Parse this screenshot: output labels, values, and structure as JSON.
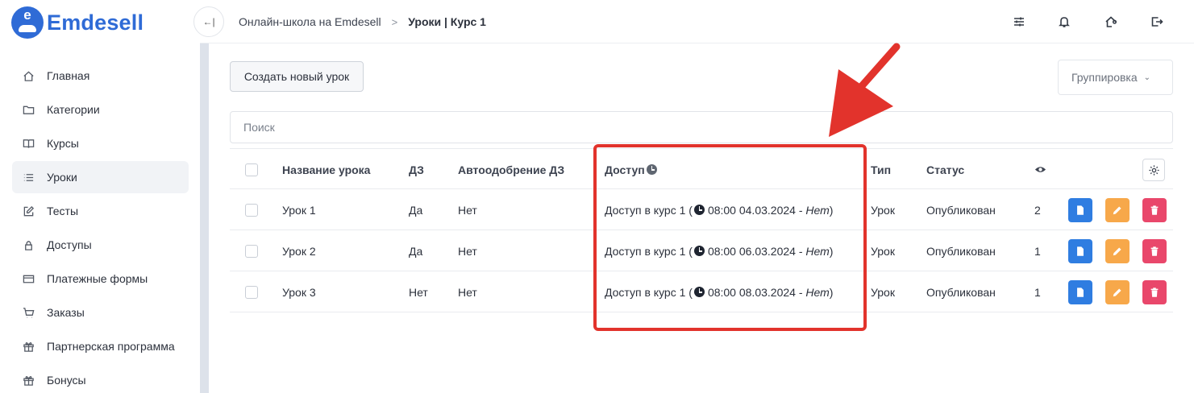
{
  "brand": {
    "name": "Emdesell",
    "logo_letter": "e",
    "color": "#2f6bd6"
  },
  "sidebar": {
    "items": [
      {
        "label": "Главная",
        "icon": "home-icon",
        "active": false
      },
      {
        "label": "Категории",
        "icon": "folder-icon",
        "active": false
      },
      {
        "label": "Курсы",
        "icon": "book-icon",
        "active": false
      },
      {
        "label": "Уроки",
        "icon": "list-icon",
        "active": true
      },
      {
        "label": "Тесты",
        "icon": "edit-square-icon",
        "active": false
      },
      {
        "label": "Доступы",
        "icon": "lock-icon",
        "active": false
      },
      {
        "label": "Платежные формы",
        "icon": "credit-card-icon",
        "active": false
      },
      {
        "label": "Заказы",
        "icon": "cart-icon",
        "active": false
      },
      {
        "label": "Партнерская программа",
        "icon": "gift-icon",
        "active": false
      },
      {
        "label": "Бонусы",
        "icon": "gift-icon",
        "active": false
      }
    ]
  },
  "header": {
    "collapse_label": "←|",
    "breadcrumbs": [
      "Онлайн-школа на Emdesell",
      "Уроки | Курс 1"
    ],
    "separator": ">",
    "icons": [
      "sliders-icon",
      "bell-icon",
      "home-settings-icon",
      "logout-icon"
    ]
  },
  "toolbar": {
    "create_label": "Создать новый урок",
    "grouping_label": "Группировка"
  },
  "search": {
    "placeholder": "Поиск",
    "value": ""
  },
  "table": {
    "columns": {
      "name": "Название урока",
      "hw": "ДЗ",
      "auto": "Автоодобрение ДЗ",
      "access": "Доступ",
      "type": "Тип",
      "status": "Статус"
    },
    "rows": [
      {
        "name": "Урок 1",
        "hw": "Да",
        "auto": "Нет",
        "access_text": "Доступ в курс 1 (",
        "access_time": "08:00 04.03.2024",
        "access_dash": " - ",
        "access_end": "Нет",
        "access_close": ")",
        "type": "Урок",
        "status": "Опубликован",
        "views": "2"
      },
      {
        "name": "Урок 2",
        "hw": "Да",
        "auto": "Нет",
        "access_text": "Доступ в курс 1 (",
        "access_time": "08:00 06.03.2024",
        "access_dash": " - ",
        "access_end": "Нет",
        "access_close": ")",
        "type": "Урок",
        "status": "Опубликован",
        "views": "1"
      },
      {
        "name": "Урок 3",
        "hw": "Нет",
        "auto": "Нет",
        "access_text": "Доступ в курс 1 (",
        "access_time": "08:00 08.03.2024",
        "access_dash": " - ",
        "access_end": "Нет",
        "access_close": ")",
        "type": "Урок",
        "status": "Опубликован",
        "views": "1"
      }
    ]
  },
  "colors": {
    "doc_button": "#2f7de1",
    "edit_button": "#f7a84a",
    "delete_button": "#e9476b",
    "annotation": "#e2332c"
  }
}
